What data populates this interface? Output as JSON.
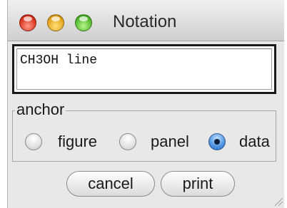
{
  "window": {
    "title": "Notation"
  },
  "text": {
    "value": "CH3OH line"
  },
  "anchor": {
    "legend": "anchor",
    "options": [
      {
        "label": "figure",
        "selected": false
      },
      {
        "label": "panel",
        "selected": false
      },
      {
        "label": "data",
        "selected": true
      }
    ]
  },
  "buttons": {
    "cancel": "cancel",
    "print": "print"
  }
}
